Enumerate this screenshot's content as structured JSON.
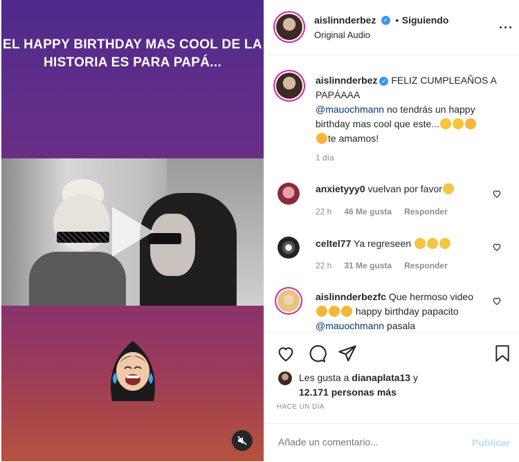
{
  "media": {
    "caption_line1": "EL HAPPY BIRTHDAY MAS COOL DE LA",
    "caption_line2": "HISTORIA ES PARA PAPÁ..."
  },
  "header": {
    "username": "aislinnderbez",
    "follow_separator": "•",
    "follow_label": "Siguiendo",
    "audio_label": "Original Audio",
    "more_icon": "more-dots-icon"
  },
  "caption": {
    "username": "aislinnderbez",
    "text_a": "FELIZ CUMPLEAÑOS A PAPÁAAA",
    "mention": "@mauochmann",
    "text_b": "no tendrás un happy birthday mas cool que este...",
    "text_c": "te amamos!",
    "time": "1 día"
  },
  "comments": [
    {
      "username": "anxietyyy0",
      "text": "vuelvan por favor",
      "time": "22 h",
      "likes": "46 Me gusta",
      "reply": "Responder"
    },
    {
      "username": "celtel77",
      "text": "Ya regreseen",
      "time": "22 h",
      "likes": "31 Me gusta",
      "reply": "Responder"
    },
    {
      "username": "aislinnderbezfc",
      "text_a": "Que hermoso video",
      "text_b": "happy birthday papacito",
      "mention": "@mauochmann",
      "text_c": "pasala"
    }
  ],
  "likes": {
    "prefix": "Les gusta a",
    "user": "dianaplata13",
    "conj": "y",
    "count": "12.171 personas más"
  },
  "timestamp": "HACE UN DÍA",
  "comment_box": {
    "placeholder": "Añade un comentario...",
    "publish": "Publicar"
  },
  "colors": {
    "accent_blue": "#0095f6",
    "publish_disabled": "#b2dffc",
    "link": "#00376b",
    "muted": "#8e8e8e",
    "story_ring": "#d6249f"
  }
}
